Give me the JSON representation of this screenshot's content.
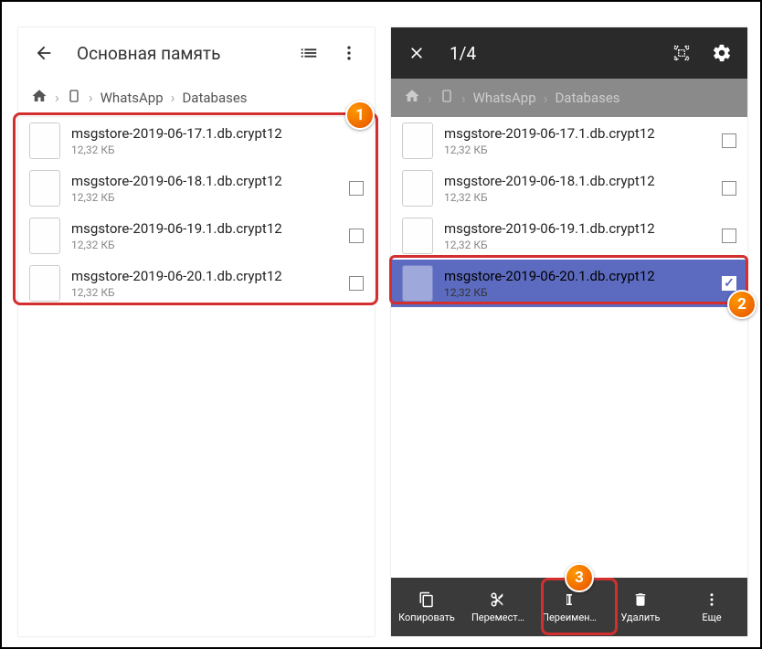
{
  "left": {
    "title": "Основная память",
    "breadcrumb": [
      "WhatsApp",
      "Databases"
    ],
    "files": [
      {
        "name": "msgstore-2019-06-17.1.db.crypt12",
        "size": "12,32 КБ"
      },
      {
        "name": "msgstore-2019-06-18.1.db.crypt12",
        "size": "12,32 КБ"
      },
      {
        "name": "msgstore-2019-06-19.1.db.crypt12",
        "size": "12,32 КБ"
      },
      {
        "name": "msgstore-2019-06-20.1.db.crypt12",
        "size": "12,32 КБ"
      }
    ]
  },
  "right": {
    "selection_count": "1/4",
    "breadcrumb": [
      "WhatsApp",
      "Databases"
    ],
    "files": [
      {
        "name": "msgstore-2019-06-17.1.db.crypt12",
        "size": "12,32 КБ",
        "selected": false
      },
      {
        "name": "msgstore-2019-06-18.1.db.crypt12",
        "size": "12,32 КБ",
        "selected": false
      },
      {
        "name": "msgstore-2019-06-19.1.db.crypt12",
        "size": "12,32 КБ",
        "selected": false
      },
      {
        "name": "msgstore-2019-06-20.1.db.crypt12",
        "size": "12,32 КБ",
        "selected": true
      }
    ],
    "actions": {
      "copy": "Копировать",
      "move": "Перемест…",
      "rename": "Переимен…",
      "delete": "Удалить",
      "more": "Еще"
    }
  },
  "badges": {
    "b1": "1",
    "b2": "2",
    "b3": "3"
  }
}
